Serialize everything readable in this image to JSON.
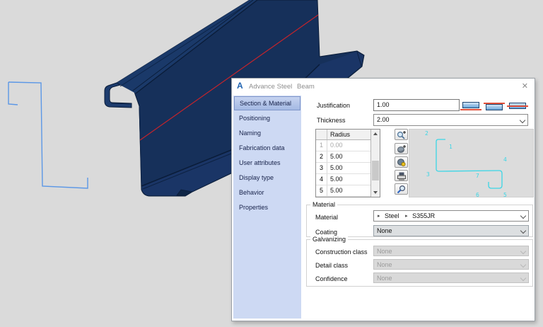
{
  "window": {
    "logo_letter": "A",
    "app_title": "Advance Steel",
    "doc_title": "Beam",
    "close_glyph": "✕"
  },
  "sidebar": {
    "items": [
      {
        "label": "Section & Material",
        "selected": true
      },
      {
        "label": "Positioning"
      },
      {
        "label": "Naming"
      },
      {
        "label": "Fabrication data"
      },
      {
        "label": "User attributes"
      },
      {
        "label": "Display type"
      },
      {
        "label": "Behavior"
      },
      {
        "label": "Properties"
      }
    ]
  },
  "section_material": {
    "justification": {
      "label": "Justification",
      "value": "1.00"
    },
    "thickness": {
      "label": "Thickness",
      "value": "2.00"
    },
    "radius_table": {
      "column_header": "Radius",
      "rows": [
        {
          "num": "1",
          "radius": "0.00",
          "disabled": true
        },
        {
          "num": "2",
          "radius": "5.00"
        },
        {
          "num": "3",
          "radius": "5.00"
        },
        {
          "num": "4",
          "radius": "5.00"
        },
        {
          "num": "5",
          "radius": "5.00"
        }
      ]
    },
    "tool_buttons": [
      {
        "icon": "zoom-in"
      },
      {
        "icon": "orbit-add"
      },
      {
        "icon": "render-mode"
      },
      {
        "icon": "print"
      },
      {
        "icon": "zoom-window"
      }
    ],
    "preview": {
      "point_labels": [
        "1",
        "2",
        "3",
        "4",
        "5",
        "6",
        "7"
      ],
      "arrow_glyph": "▸"
    },
    "material_group": {
      "title": "Material",
      "material": {
        "label": "Material",
        "breadcrumb": [
          "Steel",
          "S355JR"
        ]
      },
      "coating": {
        "label": "Coating",
        "value": "None"
      }
    },
    "galvanizing_group": {
      "title": "Galvanizing",
      "rows": [
        {
          "label": "Construction class",
          "value": "None"
        },
        {
          "label": "Detail class",
          "value": "None"
        },
        {
          "label": "Confidence",
          "value": "None"
        }
      ]
    }
  },
  "colors": {
    "beam_navy": "#16305a",
    "beam_flange": "#1a3969",
    "red_centerline": "#c2242c",
    "preview_cyan": "#3bd6e6",
    "sketch_blue": "#5b97e6",
    "sidebar_bg": "#cdd9f3",
    "sidebar_selected": "#a4b9e3",
    "viewport_bg": "#dadada"
  }
}
